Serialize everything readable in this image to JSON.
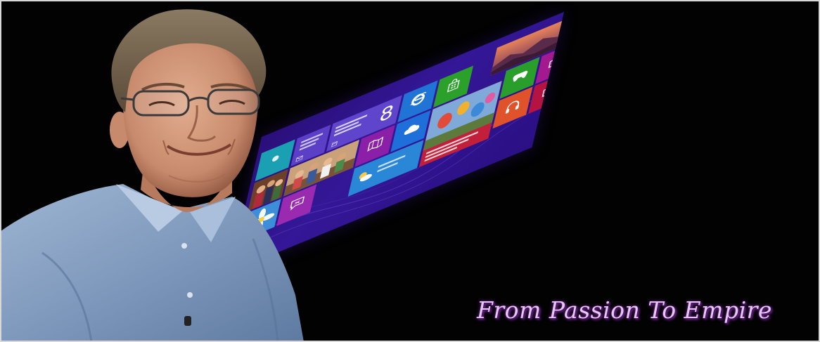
{
  "slogan": {
    "text": "From Passion To Empire",
    "color": "#e6c6f2",
    "glow_color": "#7a2aa0"
  },
  "start_screen": {
    "background_color": "#2f148c",
    "tiles": [
      {
        "id": "weather-teal",
        "icon": "sun-icon",
        "color": "#1ba0b3"
      },
      {
        "id": "mail",
        "icon": "mail-icon",
        "color": "#5b3fc7"
      },
      {
        "id": "calendar",
        "icon": "calendar-icon",
        "color": "#5f45cc",
        "day": "8"
      },
      {
        "id": "internet-explorer",
        "icon": "internet-explorer-icon",
        "color": "#1f74d6"
      },
      {
        "id": "store",
        "icon": "store-bag-icon",
        "color": "#2ba12b"
      },
      {
        "id": "people-photos",
        "icon": "people-photo-icon",
        "color": "#8a5a3a"
      },
      {
        "id": "family-photo",
        "icon": "family-photo-icon",
        "color": "#a77a55"
      },
      {
        "id": "maps",
        "icon": "maps-icon",
        "color": "#8c1fa8"
      },
      {
        "id": "skydrive",
        "icon": "cloud-icon",
        "color": "#1e6fd9"
      },
      {
        "id": "flower-photo",
        "icon": "flower-icon",
        "color": "#3c8ed8"
      },
      {
        "id": "messaging",
        "icon": "chat-bubble-icon",
        "color": "#9a2bb0"
      },
      {
        "id": "weather",
        "icon": "sun-cloud-icon",
        "color": "#2a86d6"
      },
      {
        "id": "news-balloons",
        "icon": "balloons-photo-icon",
        "color": "#c21f3a"
      },
      {
        "id": "bing",
        "icon": "landscape-photo-icon",
        "color": "#b0503c"
      },
      {
        "id": "games",
        "icon": "game-controller-icon",
        "color": "#2a9e2a"
      },
      {
        "id": "camera",
        "icon": "camera-icon",
        "color": "#a3198f"
      },
      {
        "id": "music",
        "icon": "headphones-icon",
        "color": "#e0522a"
      },
      {
        "id": "video",
        "icon": "video-icon",
        "color": "#b51442"
      }
    ]
  }
}
